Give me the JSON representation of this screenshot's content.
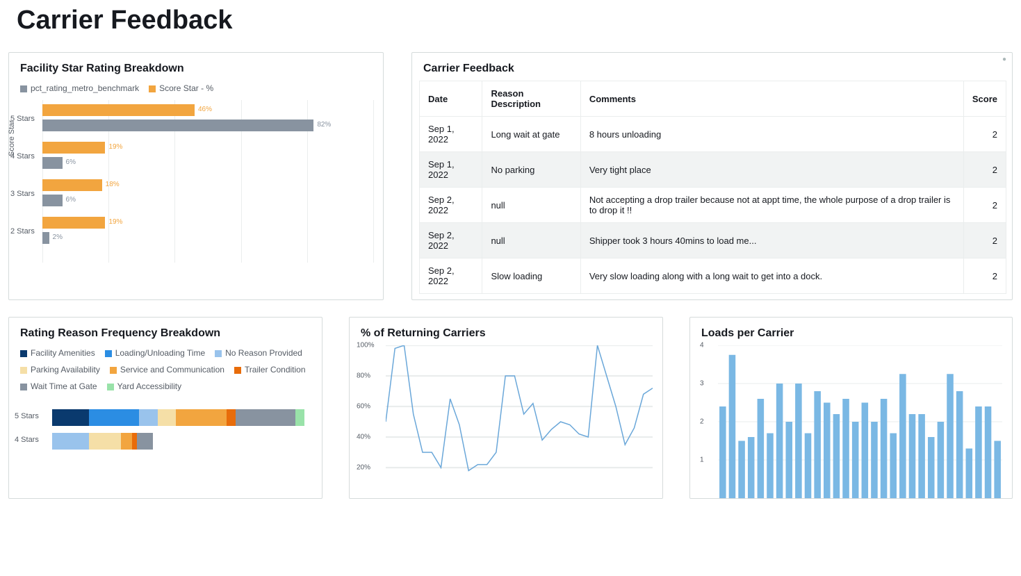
{
  "page": {
    "title": "Carrier Feedback"
  },
  "star_panel": {
    "title": "Facility Star Rating Breakdown",
    "legend": [
      {
        "label": "pct_rating_metro_benchmark",
        "color": "#8893a0"
      },
      {
        "label": "Score Star - %",
        "color": "#f2a53f"
      }
    ],
    "y_axis_label": "Score Star"
  },
  "feedback_panel": {
    "title": "Carrier Feedback",
    "columns": {
      "date": "Date",
      "reason": "Reason Description",
      "comments": "Comments",
      "score": "Score"
    },
    "rows": [
      {
        "date": "Sep 1, 2022",
        "reason": "Long wait at gate",
        "comments": "8 hours unloading",
        "score": "2"
      },
      {
        "date": "Sep 1, 2022",
        "reason": "No parking",
        "comments": "Very tight place",
        "score": "2"
      },
      {
        "date": "Sep 2, 2022",
        "reason": "null",
        "comments": "Not accepting a drop trailer because not at appt time, the whole purpose of a drop trailer is to drop it !!",
        "score": "2"
      },
      {
        "date": "Sep 2, 2022",
        "reason": "null",
        "comments": "Shipper took 3 hours 40mins to load me...",
        "score": "2"
      },
      {
        "date": "Sep 2, 2022",
        "reason": "Slow loading",
        "comments": "Very slow loading along with a long wait to get into a dock.",
        "score": "2"
      }
    ]
  },
  "reason_panel": {
    "title": "Rating Reason Frequency Breakdown",
    "legend": [
      {
        "label": "Facility Amenities",
        "color": "#0a3a6e"
      },
      {
        "label": "Loading/Unloading Time",
        "color": "#2b8de3"
      },
      {
        "label": "No Reason Provided",
        "color": "#99c3ec"
      },
      {
        "label": "Parking Availability",
        "color": "#f5dfa7"
      },
      {
        "label": "Service and Communication",
        "color": "#f2a53f"
      },
      {
        "label": "Trailer Condition",
        "color": "#e86c0a"
      },
      {
        "label": "Wait Time at Gate",
        "color": "#8893a0"
      },
      {
        "label": "Yard Accessibility",
        "color": "#99e2a9"
      }
    ]
  },
  "returning_panel": {
    "title": "% of Returning Carriers"
  },
  "loads_panel": {
    "title": "Loads per Carrier"
  },
  "chart_data": [
    {
      "id": "facility_star_rating",
      "type": "bar",
      "orientation": "horizontal",
      "title": "Facility Star Rating Breakdown",
      "ylabel": "Score Star",
      "categories": [
        "5 Stars",
        "4 Stars",
        "3 Stars",
        "2 Stars"
      ],
      "series": [
        {
          "name": "Score Star - %",
          "color": "#f2a53f",
          "values": [
            46,
            19,
            18,
            19
          ]
        },
        {
          "name": "pct_rating_metro_benchmark",
          "color": "#8893a0",
          "values": [
            82,
            6,
            6,
            2
          ]
        }
      ],
      "unit": "%",
      "xlim": [
        0,
        100
      ]
    },
    {
      "id": "carrier_feedback_table",
      "type": "table",
      "title": "Carrier Feedback",
      "columns": [
        "Date",
        "Reason Description",
        "Comments",
        "Score"
      ],
      "rows": [
        [
          "Sep 1, 2022",
          "Long wait at gate",
          "8 hours unloading",
          2
        ],
        [
          "Sep 1, 2022",
          "No parking",
          "Very tight place",
          2
        ],
        [
          "Sep 2, 2022",
          "null",
          "Not accepting a drop trailer because not at appt time, the whole purpose of a drop trailer is to drop it !!",
          2
        ],
        [
          "Sep 2, 2022",
          "null",
          "Shipper took 3 hours 40mins to load me...",
          2
        ],
        [
          "Sep 2, 2022",
          "Slow loading",
          "Very slow loading along with a long wait to get into a dock.",
          2
        ]
      ]
    },
    {
      "id": "rating_reason_frequency",
      "type": "bar",
      "stacked": true,
      "orientation": "horizontal",
      "title": "Rating Reason Frequency Breakdown",
      "categories": [
        "5 Stars",
        "4 Stars"
      ],
      "series": [
        {
          "name": "Facility Amenities",
          "color": "#0a3a6e",
          "values": [
            16,
            0
          ]
        },
        {
          "name": "Loading/Unloading Time",
          "color": "#2b8de3",
          "values": [
            22,
            0
          ]
        },
        {
          "name": "No Reason Provided",
          "color": "#99c3ec",
          "values": [
            8,
            16
          ]
        },
        {
          "name": "Parking Availability",
          "color": "#f5dfa7",
          "values": [
            8,
            14
          ]
        },
        {
          "name": "Service and Communication",
          "color": "#f2a53f",
          "values": [
            22,
            5
          ]
        },
        {
          "name": "Trailer Condition",
          "color": "#e86c0a",
          "values": [
            4,
            2
          ]
        },
        {
          "name": "Wait Time at Gate",
          "color": "#8893a0",
          "values": [
            26,
            7
          ]
        },
        {
          "name": "Yard Accessibility",
          "color": "#99e2a9",
          "values": [
            4,
            0
          ]
        }
      ],
      "unit": "%"
    },
    {
      "id": "pct_returning_carriers",
      "type": "line",
      "title": "% of Returning Carriers",
      "ylabel": "",
      "xlabel": "",
      "ylim": [
        0,
        100
      ],
      "y_ticks": [
        20,
        40,
        60,
        80,
        100
      ],
      "x": [
        0,
        1,
        2,
        3,
        4,
        5,
        6,
        7,
        8,
        9,
        10,
        11,
        12,
        13,
        14,
        15,
        16,
        17,
        18,
        19,
        20,
        21,
        22,
        23,
        24,
        25,
        26,
        27,
        28,
        29
      ],
      "values": [
        50,
        98,
        100,
        55,
        30,
        30,
        20,
        65,
        48,
        18,
        22,
        22,
        30,
        80,
        80,
        55,
        62,
        38,
        45,
        50,
        48,
        42,
        40,
        100,
        80,
        60,
        35,
        46,
        68,
        72
      ]
    },
    {
      "id": "loads_per_carrier",
      "type": "bar",
      "title": "Loads per Carrier",
      "ylim": [
        0,
        4
      ],
      "y_ticks": [
        1,
        2,
        3,
        4
      ],
      "categories": [
        0,
        1,
        2,
        3,
        4,
        5,
        6,
        7,
        8,
        9,
        10,
        11,
        12,
        13,
        14,
        15,
        16,
        17,
        18,
        19,
        20,
        21,
        22,
        23,
        24,
        25,
        26,
        27,
        28,
        29
      ],
      "values": [
        2.4,
        3.75,
        1.5,
        1.6,
        2.6,
        1.7,
        3.0,
        2.0,
        3.0,
        1.7,
        2.8,
        2.5,
        2.2,
        2.6,
        2.0,
        2.5,
        2.0,
        2.6,
        1.7,
        3.25,
        2.2,
        2.2,
        1.6,
        2.0,
        3.25,
        2.8,
        1.3,
        2.4,
        2.4,
        1.5
      ]
    }
  ]
}
